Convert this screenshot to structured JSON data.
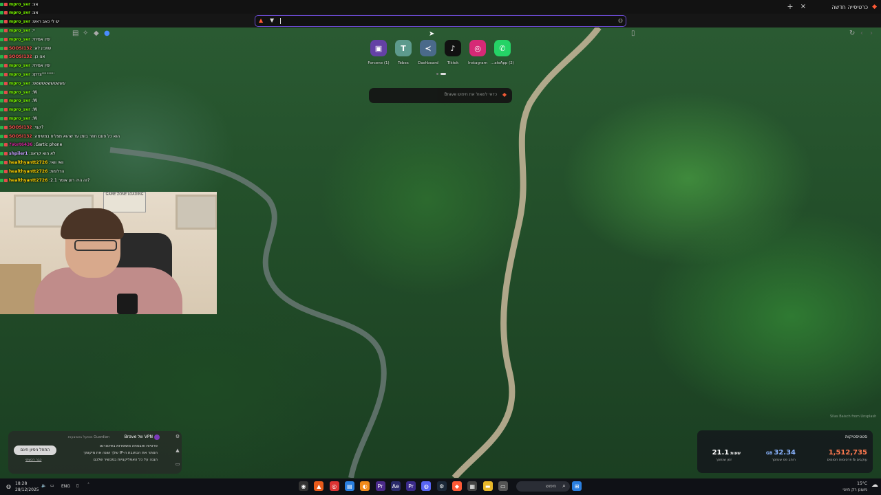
{
  "browser": {
    "tab_title": "כרטיסייה חדשה",
    "tab_close": "×",
    "new_tab": "+",
    "address_value": ""
  },
  "speed_dial": [
    {
      "label": "Forcene (1)",
      "icon": "twitch-icon",
      "glyph": "▣",
      "color": "#6441a5"
    },
    {
      "label": "Tebex",
      "icon": "tebex-icon",
      "glyph": "T",
      "color": "#5d9a8d"
    },
    {
      "label": "Dashboard",
      "icon": "dashboard-icon",
      "glyph": "≺",
      "color": "#4a6a8a"
    },
    {
      "label": "Tiktok",
      "icon": "tiktok-icon",
      "glyph": "♪",
      "color": "#111111"
    },
    {
      "label": "Instagram",
      "icon": "instagram-icon",
      "glyph": "◎",
      "color": "#d62976"
    },
    {
      "label": "...atsApp (2)",
      "icon": "whatsapp-icon",
      "glyph": "✆",
      "color": "#25d366"
    }
  ],
  "leo": {
    "placeholder": "כדאי לשאול את חיפוש Brave"
  },
  "chat": [
    {
      "user": "mpro_svr",
      "msg": "אצ",
      "color": "#7cfc00"
    },
    {
      "user": "mpro_svr",
      "msg": "אצ",
      "color": "#7cfc00"
    },
    {
      "user": "mpro_svr",
      "msg": "יש לי כאב ראש",
      "color": "#7cfc00"
    },
    {
      "user": "mpro_svr",
      "msg": "יי",
      "color": "#7cfc00"
    },
    {
      "user": "mpro_svr",
      "msg": "ימין אמיתי",
      "color": "#7cfc00"
    },
    {
      "user": "SOOSI132",
      "msg": "שתכין לא",
      "color": "#ff4f4f"
    },
    {
      "user": "SOOSI132",
      "msg": "אנו כן",
      "color": "#ff4f4f"
    },
    {
      "user": "mpro_svr",
      "msg": "ימין אמיתי",
      "color": "#7cfc00"
    },
    {
      "user": "mpro_svr",
      "msg": "צדקוֿ'''''''''''",
      "color": "#7cfc00"
    },
    {
      "user": "mpro_svr",
      "msg": "ששששששששששש",
      "color": "#7cfc00"
    },
    {
      "user": "mpro_svr",
      "msg": "W",
      "color": "#7cfc00"
    },
    {
      "user": "mpro_svr",
      "msg": "W",
      "color": "#7cfc00"
    },
    {
      "user": "mpro_svr",
      "msg": "W",
      "color": "#7cfc00"
    },
    {
      "user": "mpro_svr",
      "msg": "W",
      "color": "#7cfc00"
    },
    {
      "user": "SOOSI132",
      "msg": "קצי?",
      "color": "#ff4f4f"
    },
    {
      "user": "SOOSI132",
      "msg": "הוא כל פעם חוזר בזמן עד שהוא מצליח במשימה",
      "color": "#ff4f4f"
    },
    {
      "user": "?Vort6436",
      "msg": "Gartic phone",
      "color": "#d0249a"
    },
    {
      "user": "shpiler1",
      "msg": "לא הוא קראצ",
      "color": "#c8a0ff"
    },
    {
      "user": "healthyantt2726",
      "msg": "וואי וואי",
      "color": "#ffd000"
    },
    {
      "user": "healthyantt2726",
      "msg": "הדלפות",
      "color": "#ffd000"
    },
    {
      "user": "healthyantt2726",
      "msg": "זה היה רוון אומר 2.1?",
      "color": "#ffd000"
    }
  ],
  "webcam": {
    "screen_text": "GAME ZONE LOADING"
  },
  "vpn": {
    "title": "VPN של Brave",
    "subtitle": "מופעל באמצעות Guardian",
    "items": [
      "פרטיות ואבטחה משופרות באינטרנט",
      "הסתר את הכתובת ה-IP שלך ושנה את מיקומך",
      "הגנה על כל האפליקציות במכשיר שלכם"
    ],
    "button": "התחל ניסיון חינם",
    "link": "כבר רכשתי"
  },
  "stats": {
    "title": "סטטיסטיקות",
    "items": [
      {
        "value": "1,512,735",
        "label": "עוקבים & פרסומות חסומים",
        "color": "#ff7a50"
      },
      {
        "value": "32.34",
        "unit": "GB",
        "label": "רוחב פס שנחסך",
        "color": "#8ab4ff"
      },
      {
        "value": "21.1",
        "unit": "שעות",
        "label": "זמן שנחסך",
        "color": "#ffffff"
      }
    ]
  },
  "wallpaper_credit": "Silas Baisch from Unsplash",
  "taskbar": {
    "time": "18:28",
    "date": "28/12/2025",
    "lang": "ENG",
    "search_placeholder": "חיפוש",
    "weather_temp": "15°C",
    "weather_desc": "מעונן רק חיוני"
  }
}
